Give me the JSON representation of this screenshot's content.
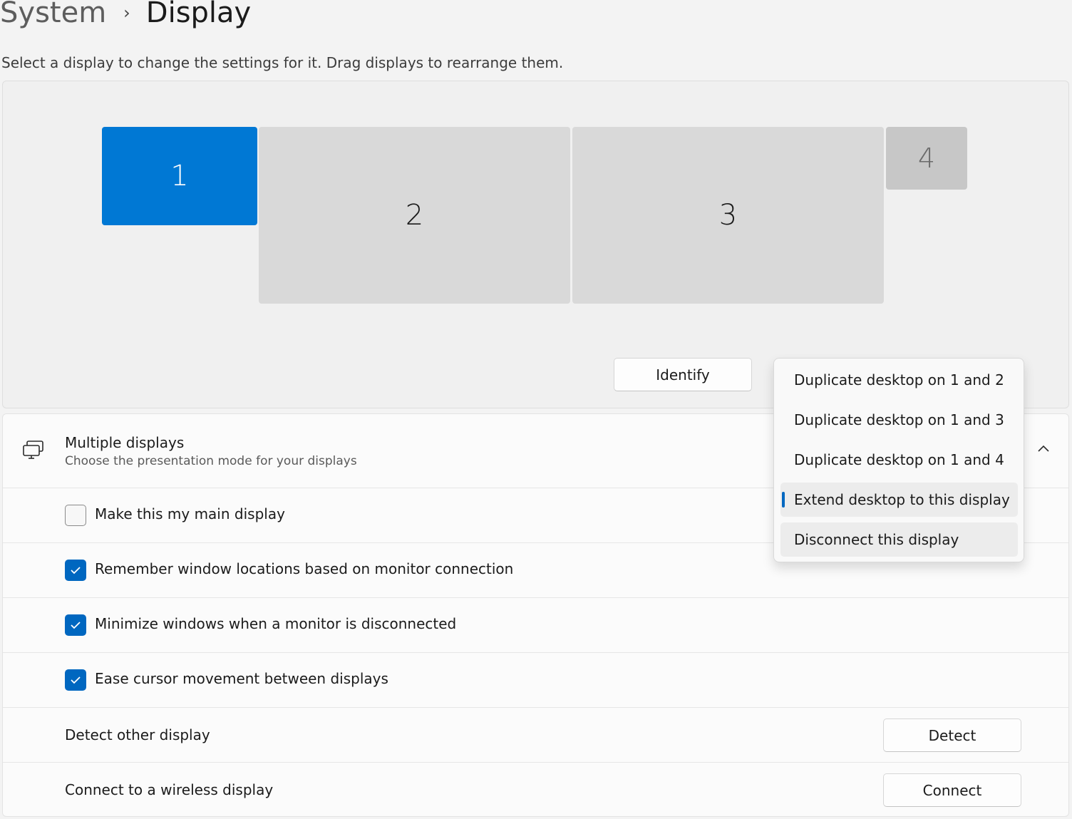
{
  "breadcrumb": {
    "parent": "System",
    "separator": "›",
    "current": "Display"
  },
  "subtitle": "Select a display to change the settings for it. Drag displays to rearrange them.",
  "monitors": [
    {
      "label": "1",
      "selected": true
    },
    {
      "label": "2",
      "selected": false
    },
    {
      "label": "3",
      "selected": false
    },
    {
      "label": "4",
      "selected": false
    }
  ],
  "identify_label": "Identify",
  "dropdown": {
    "options": [
      "Duplicate desktop on 1 and 2",
      "Duplicate desktop on 1 and 3",
      "Duplicate desktop on 1 and 4",
      "Extend desktop to this display",
      "Disconnect this display"
    ],
    "selected": "Extend desktop to this display"
  },
  "multiple_displays": {
    "title": "Multiple displays",
    "description": "Choose the presentation mode for your displays",
    "icon": "multiple-displays-icon",
    "expanded": true
  },
  "options": [
    {
      "label": "Make this my main display",
      "checked": false
    },
    {
      "label": "Remember window locations based on monitor connection",
      "checked": true
    },
    {
      "label": "Minimize windows when a monitor is disconnected",
      "checked": true
    },
    {
      "label": "Ease cursor movement between displays",
      "checked": true
    }
  ],
  "detect": {
    "label": "Detect other display",
    "button": "Detect"
  },
  "wireless": {
    "label": "Connect to a wireless display",
    "button": "Connect"
  },
  "colors": {
    "accent": "#0067c0",
    "selected_monitor": "#0078d4"
  }
}
